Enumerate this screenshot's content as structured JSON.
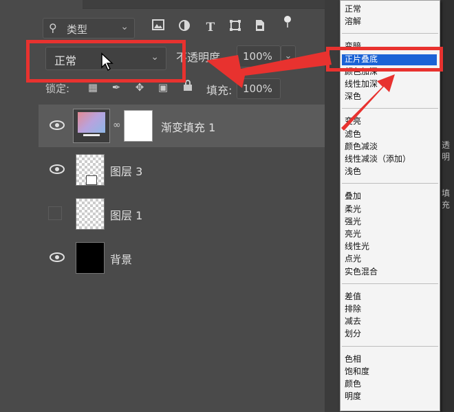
{
  "filter": {
    "kind_label": "类型"
  },
  "blend": {
    "mode": "正常"
  },
  "opacity": {
    "label": "不透明度",
    "value": "100%"
  },
  "lock": {
    "label": "锁定:"
  },
  "fill": {
    "label": "填充:",
    "value": "100%"
  },
  "layers": [
    {
      "name": "渐变填充 1",
      "visible": true
    },
    {
      "name": "图层 3",
      "visible": true
    },
    {
      "name": "图层 1",
      "visible": false
    },
    {
      "name": "背景",
      "visible": true
    }
  ],
  "blend_menu": {
    "groups": [
      [
        "正常",
        "溶解"
      ],
      [
        "变暗",
        "正片叠底",
        "颜色加深",
        "线性加深",
        "深色"
      ],
      [
        "变亮",
        "滤色",
        "颜色减淡",
        "线性减淡（添加）",
        "浅色"
      ],
      [
        "叠加",
        "柔光",
        "强光",
        "亮光",
        "线性光",
        "点光",
        "实色混合"
      ],
      [
        "差值",
        "排除",
        "减去",
        "划分"
      ],
      [
        "色相",
        "饱和度",
        "颜色",
        "明度"
      ]
    ],
    "highlighted": "正片叠底"
  },
  "edge_labels": {
    "a": "透明",
    "b": "填充"
  },
  "colors": {
    "highlight": "#1b63d6",
    "annotation": "#e8322f",
    "panel": "#4a4a4a"
  }
}
